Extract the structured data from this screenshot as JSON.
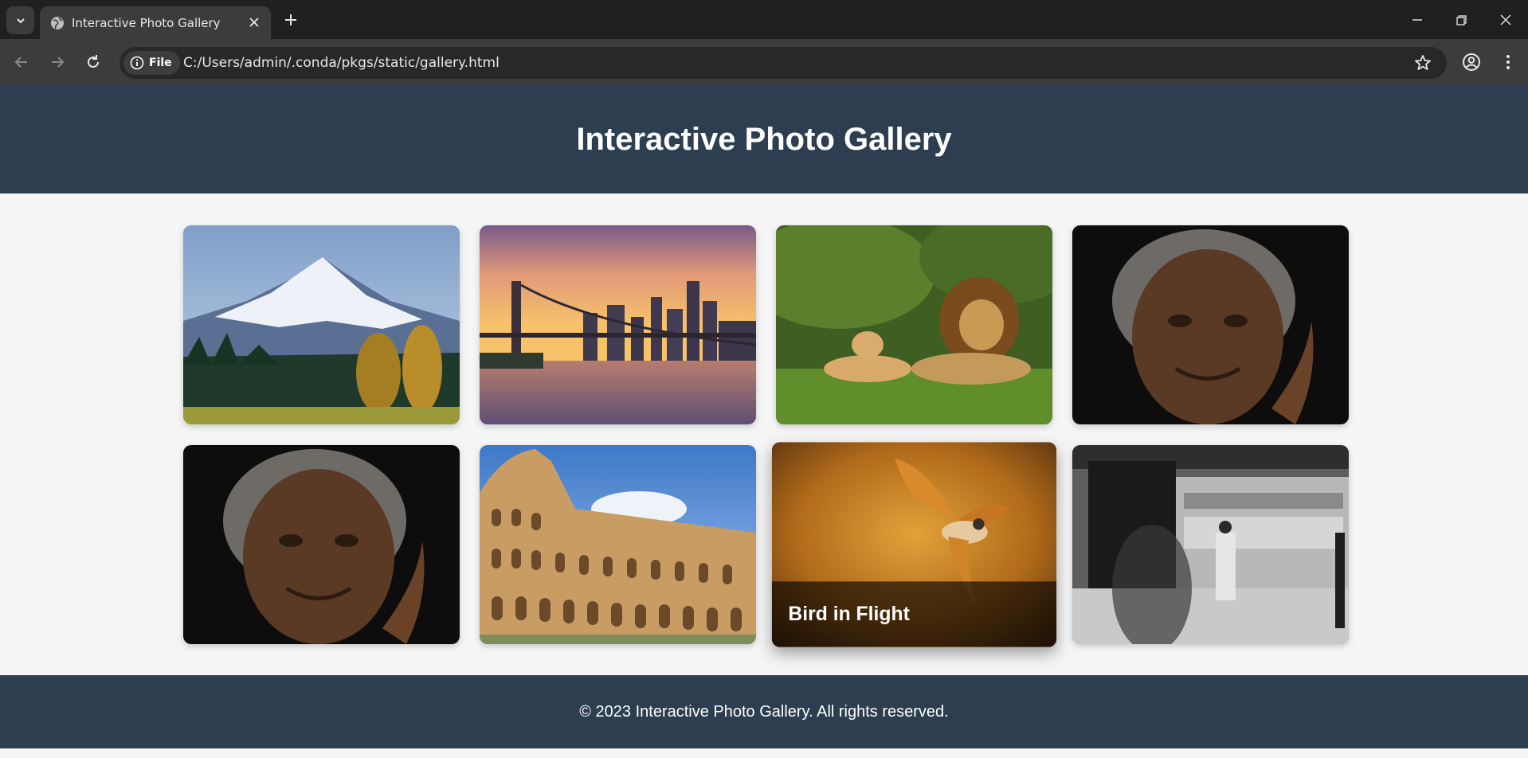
{
  "browser": {
    "tab_title": "Interactive Photo Gallery",
    "site_chip_label": "File",
    "url": "C:/Users/admin/.conda/pkgs/static/gallery.html",
    "icons": {
      "tab_search": "chevron-down-icon",
      "favicon": "globe-icon",
      "tab_close": "close-icon",
      "new_tab": "plus-icon",
      "minimize": "minimize-icon",
      "restore": "restore-icon",
      "close_window": "close-icon",
      "back": "arrow-left-icon",
      "forward": "arrow-right-icon",
      "reload": "reload-icon",
      "site_info": "info-icon",
      "bookmark": "star-icon",
      "profile": "profile-icon",
      "menu": "more-vertical-icon"
    }
  },
  "page": {
    "header": {
      "title": "Interactive Photo Gallery"
    },
    "gallery": {
      "photos": [
        {
          "subject": "snowy mountain with forest",
          "caption": ""
        },
        {
          "subject": "bridge and city skyline at sunset",
          "caption": ""
        },
        {
          "subject": "lion and lioness on grass",
          "caption": ""
        },
        {
          "subject": "portrait of elderly woman",
          "caption": ""
        },
        {
          "subject": "portrait of elderly woman",
          "caption": ""
        },
        {
          "subject": "colosseum under blue sky",
          "caption": ""
        },
        {
          "subject": "bird in flight at golden hour",
          "caption": "Bird in Flight",
          "hovered": true
        },
        {
          "subject": "black and white street scene",
          "caption": ""
        }
      ]
    },
    "footer": {
      "text": "© 2023 Interactive Photo Gallery. All rights reserved."
    }
  },
  "colors": {
    "header_bg": "#2c3e50",
    "footer_bg": "#2c3e50",
    "page_bg": "#f5f5f5",
    "chrome_tabbar": "#1f2021",
    "chrome_toolbar": "#3c3c3c"
  }
}
